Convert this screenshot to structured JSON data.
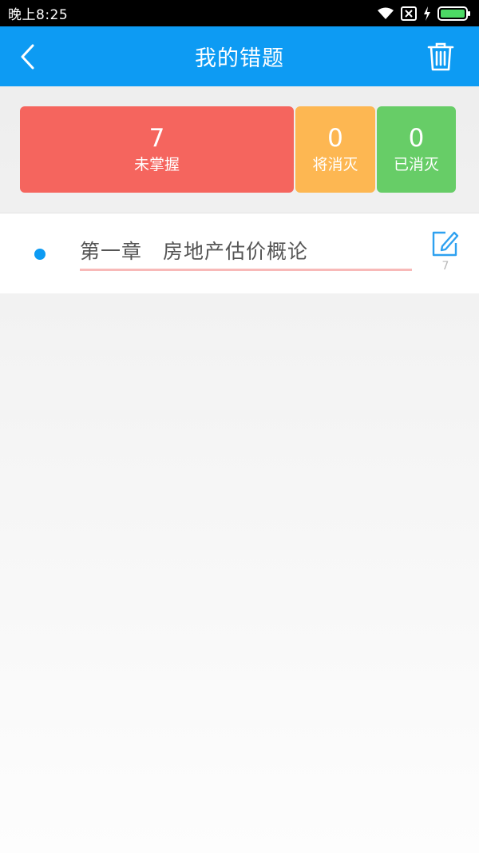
{
  "status_bar": {
    "time": "晚上8:25",
    "icons": [
      "wifi-icon",
      "sim-off-icon",
      "charging-icon",
      "battery-icon"
    ]
  },
  "app_bar": {
    "title": "我的错题",
    "back_icon": "back-arrow-icon",
    "delete_icon": "trash-icon",
    "color": "#0d9bf3"
  },
  "stats": [
    {
      "value": "7",
      "label": "未掌握",
      "color": "#f5655e"
    },
    {
      "value": "0",
      "label": "将消灭",
      "color": "#fdb752"
    },
    {
      "value": "0",
      "label": "已消灭",
      "color": "#67cd67"
    }
  ],
  "chapters": [
    {
      "title": "第一章　房地产估价概论",
      "count": "7",
      "edit_icon": "edit-icon"
    }
  ]
}
